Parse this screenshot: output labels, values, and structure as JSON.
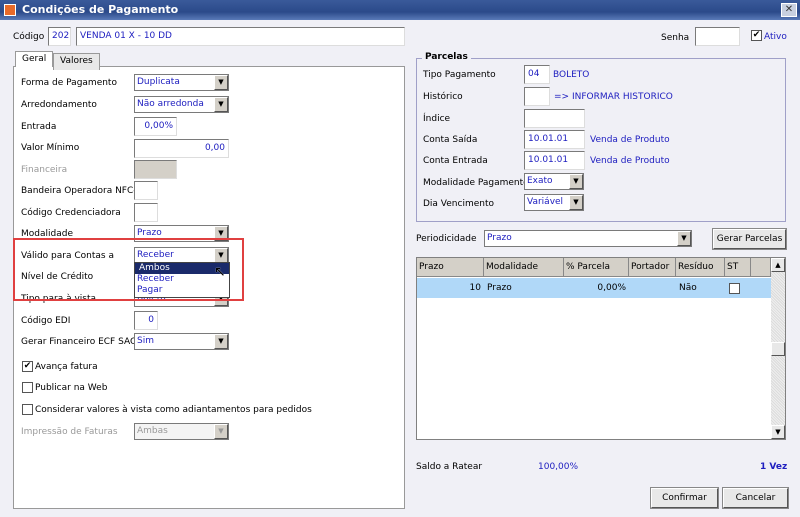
{
  "window": {
    "title": "Condições de Pagamento",
    "close_icon": "close-icon"
  },
  "header": {
    "codigo_label": "Código",
    "codigo": "202",
    "descricao": "VENDA 01 X - 10 DD",
    "senha_label": "Senha",
    "senha": "",
    "ativo_label": "Ativo",
    "ativo": true
  },
  "tabs": [
    {
      "label": "Geral",
      "active": true
    },
    {
      "label": "Valores",
      "active": false
    }
  ],
  "geral": {
    "forma_pagamento": {
      "label": "Forma de Pagamento",
      "value": "Duplicata"
    },
    "arredondamento": {
      "label": "Arredondamento",
      "value": "Não arredonda"
    },
    "entrada": {
      "label": "Entrada",
      "value": "0,00%"
    },
    "valor_minimo": {
      "label": "Valor Mínimo",
      "value": "0,00"
    },
    "financeira": {
      "label": "Financeira",
      "value": ""
    },
    "bandeira": {
      "label": "Bandeira Operadora NFC-e",
      "value": ""
    },
    "credenciadora": {
      "label": "Código Credenciadora",
      "value": ""
    },
    "modalidade": {
      "label": "Modalidade",
      "value": "Prazo"
    },
    "valido_contas": {
      "label": "Válido para Contas a",
      "value": "Receber",
      "options": [
        "Ambos",
        "Receber",
        "Pagar"
      ],
      "highlighted": "Ambos"
    },
    "nivel_credito": {
      "label": "Nível de Crédito"
    },
    "tipo_vista": {
      "label": "Tipo para à vista",
      "value": "Boleto"
    },
    "codigo_edi": {
      "label": "Código EDI",
      "value": "0"
    },
    "gerar_financeiro": {
      "label": "Gerar Financeiro ECF SAC",
      "value": "Sim"
    },
    "avanca_fatura": {
      "label": "Avança fatura",
      "checked": true
    },
    "publicar_web": {
      "label": "Publicar na Web",
      "checked": false
    },
    "considerar_vista": {
      "label": "Considerar valores à vista como adiantamentos para pedidos",
      "checked": false
    },
    "impressao_faturas": {
      "label": "Impressão de Faturas",
      "value": "Ambas"
    }
  },
  "parcelas": {
    "title": "Parcelas",
    "tipo_pagamento": {
      "label": "Tipo Pagamento",
      "code": "04",
      "desc": "BOLETO"
    },
    "historico": {
      "label": "Histórico",
      "code": "",
      "desc": "=> INFORMAR HISTORICO"
    },
    "indice": {
      "label": "Índice",
      "value": ""
    },
    "conta_saida": {
      "label": "Conta Saída",
      "code": "10.01.01",
      "desc": "Venda de Produto"
    },
    "conta_entrada": {
      "label": "Conta Entrada",
      "code": "10.01.01",
      "desc": "Venda de Produto"
    },
    "modalidade_pagamento": {
      "label": "Modalidade Pagamento",
      "value": "Exato"
    },
    "dia_vencimento": {
      "label": "Dia Vencimento",
      "value": "Variável"
    }
  },
  "periodicidade": {
    "label": "Periodicidade",
    "value": "Prazo",
    "gerar_label": "Gerar Parcelas"
  },
  "grid": {
    "columns": [
      "Prazo",
      "Modalidade",
      "% Parcela",
      "Portador",
      "Resíduo",
      "ST"
    ],
    "rows": [
      {
        "prazo": "10",
        "modalidade": "Prazo",
        "parcela": "0,00%",
        "portador": "",
        "residuo": "Não",
        "st": false
      }
    ]
  },
  "footer": {
    "saldo_label": "Saldo a Ratear",
    "saldo": "100,00%",
    "vezes": "1 Vez",
    "confirmar": "Confirmar",
    "cancelar": "Cancelar"
  },
  "colors": {
    "titlebar": "#2b4a8a",
    "value_text": "#2020c0",
    "selected_row": "#b0d8f8",
    "highlight": "#e04040"
  }
}
